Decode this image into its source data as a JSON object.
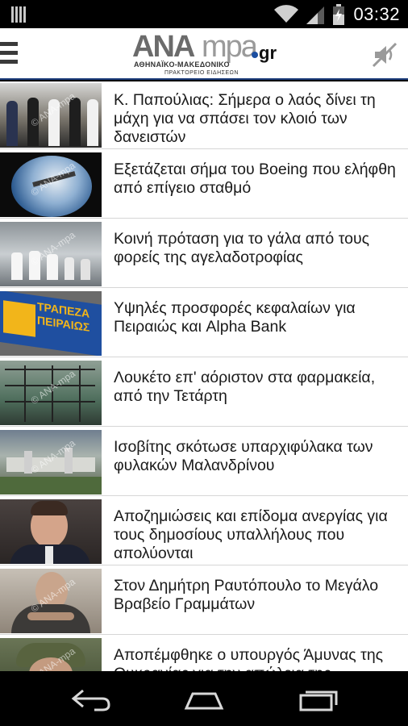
{
  "status_bar": {
    "time": "03:32",
    "icons": [
      "notification-bars-icon",
      "wifi-icon",
      "cell-signal-icon",
      "battery-icon"
    ]
  },
  "header": {
    "logo_ana": "ANA",
    "logo_mpa": "mpa",
    "logo_domain": "gr",
    "logo_subtitle": "ΑΘΗΝΑΪΚΟ-ΜΑΚΕΔΟΝΙΚΟ",
    "logo_tagline": "ΠΡΑΚΤΟΡΕΙΟ ΕΙΔΗΣΕΩΝ",
    "icons": [
      "menu-icon",
      "mute-icon"
    ]
  },
  "news": [
    {
      "headline": "Κ. Παπούλιας: Σήμερα ο λαός δίνει τη μάχη για να σπάσει τον κλοιό των δανειστών",
      "thumb_color": "#6e6a62"
    },
    {
      "headline": "Εξετάζεται σήμα του Boeing που ελήφθη από επίγειο σταθμό",
      "thumb_color": "#3d6a9c"
    },
    {
      "headline": "Κοινή πρόταση για το γάλα από τους φορείς της αγελαδοτροφίας",
      "thumb_color": "#a8b0b4"
    },
    {
      "headline": "Υψηλές προσφορές κεφαλαίων για Πειραιώς και Alpha Bank",
      "thumb_color": "#1f4fa0",
      "thumb_text": "ΤΡΑΠΕΖΑ ΠΕΙΡΑΙΩΣ"
    },
    {
      "headline": "Λουκέτο επ' αόριστον στα φαρμακεία, από την Τετάρτη",
      "thumb_color": "#3f6b52"
    },
    {
      "headline": "Ισοβίτης σκότωσε υπαρχιφύλακα των φυλακών Μαλανδρίνου",
      "thumb_color": "#7f8a86"
    },
    {
      "headline": "Αποζημιώσεις και επίδομα ανεργίας για τους δημοσίους υπαλλήλους που απολύονται",
      "thumb_color": "#5a4e48"
    },
    {
      "headline": "Στον Δημήτρη Ραυτόπουλο το Μεγάλο Βραβείο Γραμμάτων",
      "thumb_color": "#9a8f84"
    },
    {
      "headline": "Αποπέμφθηκε ο υπουργός Άμυνας της Ουκρανίας για την απώλεια της",
      "thumb_color": "#55603f"
    }
  ],
  "watermark": "© ANA-mpa",
  "nav_bar": {
    "icons": [
      "back-icon",
      "home-icon",
      "recent-apps-icon"
    ]
  }
}
